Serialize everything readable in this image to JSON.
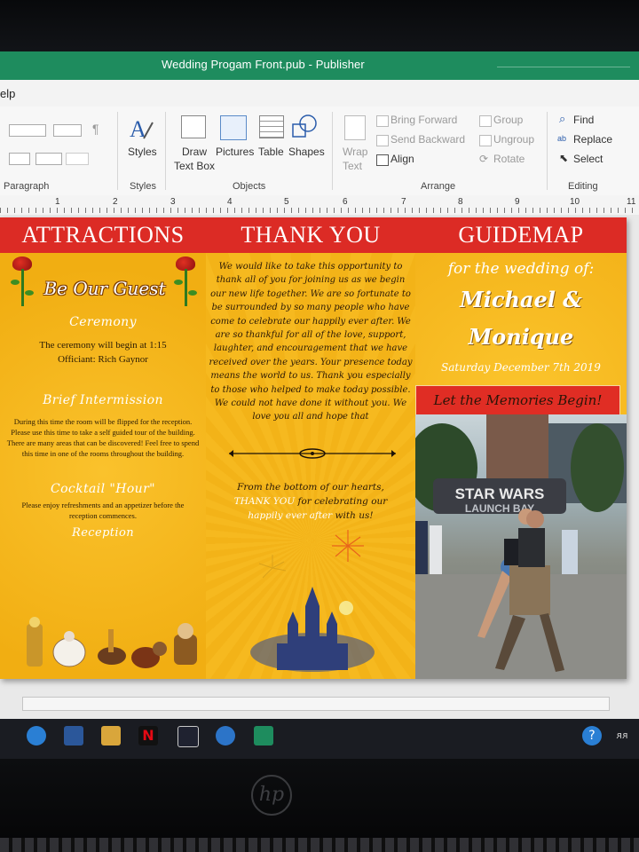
{
  "window": {
    "title": "Wedding Progam Front.pub  -  Publisher"
  },
  "menu": {
    "help_label": "elp"
  },
  "ribbon": {
    "paragraph_group": "Paragraph",
    "styles_label": "Styles",
    "styles_group": "Styles",
    "draw_text_box_line1": "Draw",
    "draw_text_box_line2": "Text Box",
    "pictures_label": "Pictures",
    "table_label": "Table",
    "shapes_label": "Shapes",
    "objects_group": "Objects",
    "wrap_text_line1": "Wrap",
    "wrap_text_line2": "Text",
    "bring_forward": "Bring Forward",
    "send_backward": "Send Backward",
    "align": "Align",
    "group": "Group",
    "ungroup": "Ungroup",
    "rotate": "Rotate",
    "arrange_group": "Arrange",
    "find": "Find",
    "replace": "Replace",
    "select": "Select",
    "editing_group": "Editing"
  },
  "ruler": {
    "ticks": [
      "1",
      "2",
      "3",
      "4",
      "5",
      "6",
      "7",
      "8",
      "9",
      "10",
      "11"
    ]
  },
  "document": {
    "panel1": {
      "header": "ATTRACTIONS",
      "guest_title": "Be Our Guest",
      "ceremony_title": "Ceremony",
      "ceremony_line1": "The ceremony will begin at 1:15",
      "ceremony_line2": "Officiant: Rich Gaynor",
      "intermission_title": "Brief Intermission",
      "intermission_text": "During this time the room will be flipped for the reception. Please use this time to take a self guided tour of the building. There are many areas that can be discovered! Feel free to spend this time in one of the rooms throughout the building.",
      "cocktail_title": "Cocktail \"Hour\"",
      "cocktail_text": "Please enjoy refreshments and an appetizer before the reception commences.",
      "reception_title": "Reception"
    },
    "panel2": {
      "header": "THANK YOU",
      "message": "We would like to take this opportunity to thank all of you for joining us as we begin our new life together. We are so fortunate to be surrounded by so many people who have come to celebrate our happily ever after. We are so thankful for all of the love, support, laughter, and encouragement that we have received over the years. Your presence today means the world to us. Thank you especially to those who helped to make today possible. We could not have done it without you. We love you all and hope that",
      "closing_line1": "From the bottom of our hearts,",
      "closing_line2a": "THANK YOU",
      "closing_line2b": " for celebrating our",
      "closing_line3a": "happily ever after",
      "closing_line3b": " with us!"
    },
    "panel3": {
      "header": "GUIDEMAP",
      "for_wedding": "for the wedding of:",
      "name1": "Michael &",
      "name2": "Monique",
      "date": "Saturday December 7th 2019",
      "memories": "Let the Memories Begin!",
      "photo_sign_line1": "STAR WARS",
      "photo_sign_line2": "LAUNCH BAY"
    }
  },
  "taskbar": {
    "icons": [
      "windows-icon",
      "word-icon",
      "file-explorer-icon",
      "netflix-icon",
      "mail-icon",
      "media-icon",
      "publisher-icon"
    ]
  },
  "hardware": {
    "brand": "hp"
  },
  "colors": {
    "title_green": "#1e8c5e",
    "header_red": "#dc2b25",
    "panel_gold": "#f4b51c"
  }
}
